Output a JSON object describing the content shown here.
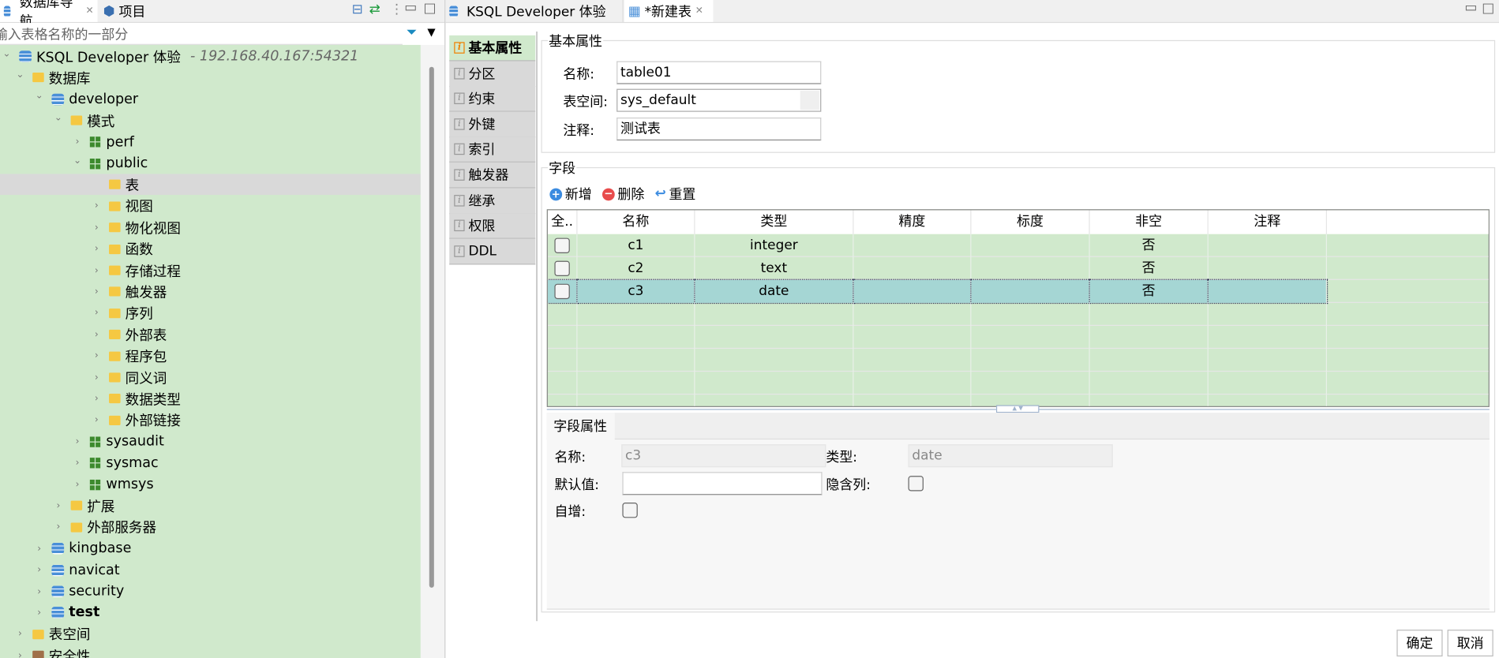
{
  "left_panel": {
    "tabs": [
      {
        "label": "数据库导航"
      },
      {
        "label": "项目"
      }
    ],
    "filter_placeholder": "输入表格名称的一部分",
    "tree": [
      {
        "label": "KSQL Developer 体验",
        "extra": "- 192.168.40.167:54321",
        "level": 0,
        "icon": "connection-icon",
        "expanded": true
      },
      {
        "label": "数据库",
        "level": 1,
        "icon": "folder-icon",
        "expanded": true
      },
      {
        "label": "developer",
        "level": 2,
        "icon": "database-icon",
        "expanded": true
      },
      {
        "label": "模式",
        "level": 3,
        "icon": "folder-icon",
        "expanded": true
      },
      {
        "label": "perf",
        "level": 4,
        "icon": "schema-icon",
        "expanded": false
      },
      {
        "label": "public",
        "level": 4,
        "icon": "schema-icon",
        "expanded": true
      },
      {
        "label": "表",
        "level": 5,
        "icon": "folder-icon",
        "selected": true,
        "leaf": true
      },
      {
        "label": "视图",
        "level": 5,
        "icon": "folder-icon"
      },
      {
        "label": "物化视图",
        "level": 5,
        "icon": "folder-icon"
      },
      {
        "label": "函数",
        "level": 5,
        "icon": "folder-icon"
      },
      {
        "label": "存储过程",
        "level": 5,
        "icon": "folder-icon"
      },
      {
        "label": "触发器",
        "level": 5,
        "icon": "folder-icon"
      },
      {
        "label": "序列",
        "level": 5,
        "icon": "folder-icon"
      },
      {
        "label": "外部表",
        "level": 5,
        "icon": "folder-icon"
      },
      {
        "label": "程序包",
        "level": 5,
        "icon": "folder-icon"
      },
      {
        "label": "同义词",
        "level": 5,
        "icon": "folder-icon"
      },
      {
        "label": "数据类型",
        "level": 5,
        "icon": "folder-icon"
      },
      {
        "label": "外部链接",
        "level": 5,
        "icon": "folder-icon"
      },
      {
        "label": "sysaudit",
        "level": 4,
        "icon": "schema-icon"
      },
      {
        "label": "sysmac",
        "level": 4,
        "icon": "schema-icon"
      },
      {
        "label": "wmsys",
        "level": 4,
        "icon": "schema-icon"
      },
      {
        "label": "扩展",
        "level": 3,
        "icon": "folder-icon"
      },
      {
        "label": "外部服务器",
        "level": 3,
        "icon": "folder-icon"
      },
      {
        "label": "kingbase",
        "level": 2,
        "icon": "database-icon"
      },
      {
        "label": "navicat",
        "level": 2,
        "icon": "database-icon"
      },
      {
        "label": "security",
        "level": 2,
        "icon": "database-icon"
      },
      {
        "label": "test",
        "level": 2,
        "icon": "database-icon",
        "bold": true
      },
      {
        "label": "表空间",
        "level": 1,
        "icon": "folder-icon"
      },
      {
        "label": "安全性",
        "level": 1,
        "icon": "lock-icon"
      }
    ]
  },
  "editor": {
    "tabs": [
      {
        "label": "KSQL Developer 体验"
      },
      {
        "label": "*新建表"
      }
    ],
    "side_tabs": [
      "基本属性",
      "分区",
      "约束",
      "外键",
      "索引",
      "触发器",
      "继承",
      "权限",
      "DDL"
    ],
    "basic": {
      "title": "基本属性",
      "name_label": "名称:",
      "name_value": "table01",
      "tablespace_label": "表空间:",
      "tablespace_value": "sys_default",
      "comment_label": "注释:",
      "comment_value": "测试表"
    },
    "fields": {
      "title": "字段",
      "toolbar": {
        "add": "新增",
        "delete": "删除",
        "reset": "重置"
      },
      "columns": [
        "全..",
        "名称",
        "类型",
        "精度",
        "标度",
        "非空",
        "注释"
      ],
      "rows": [
        {
          "name": "c1",
          "type": "integer",
          "precision": "",
          "scale": "",
          "not_null": "否",
          "comment": ""
        },
        {
          "name": "c2",
          "type": "text",
          "precision": "",
          "scale": "",
          "not_null": "否",
          "comment": ""
        },
        {
          "name": "c3",
          "type": "date",
          "precision": "",
          "scale": "",
          "not_null": "否",
          "comment": "",
          "selected": true
        }
      ]
    },
    "field_props": {
      "tab": "字段属性",
      "name_label": "名称:",
      "name_value": "c3",
      "type_label": "类型:",
      "type_value": "date",
      "default_label": "默认值:",
      "default_value": "",
      "hidden_label": "隐含列:",
      "autoinc_label": "自增:"
    },
    "ok": "确定",
    "cancel": "取消"
  },
  "colors": {
    "tree_bg": "#d0e9cc",
    "selected_row": "#a5d6d4",
    "accent": "#f08000"
  }
}
